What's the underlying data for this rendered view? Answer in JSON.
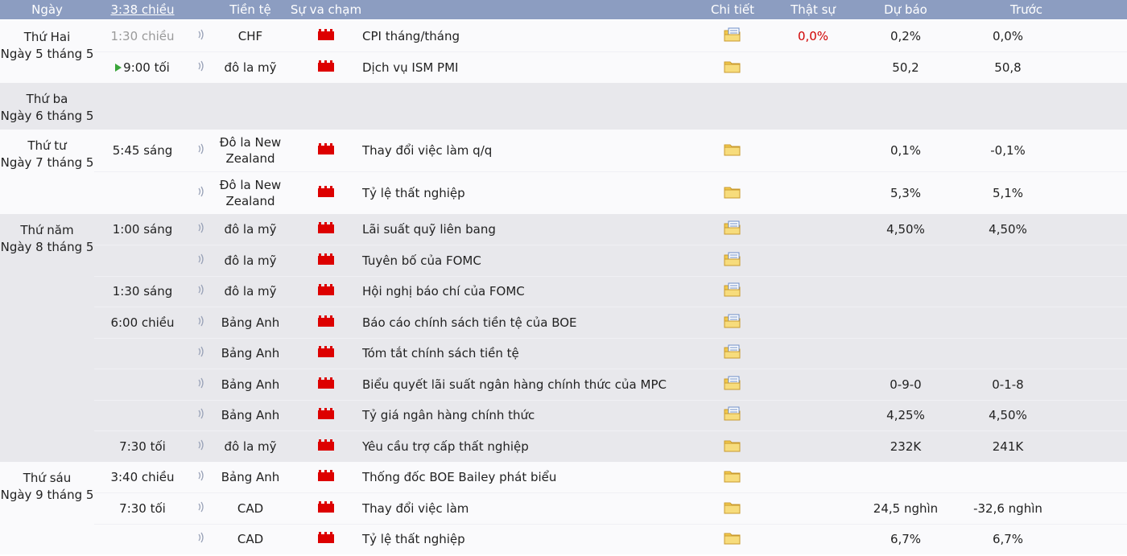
{
  "header": {
    "date": "Ngày",
    "time": "3:38 chiều",
    "currency": "Tiền tệ",
    "impact": "Sự va chạm",
    "detail": "Chi tiết",
    "actual": "Thật sự",
    "forecast": "Dự báo",
    "previous": "Trước"
  },
  "days": [
    {
      "weekday": "Thứ Hai",
      "date": "Ngày 5 tháng 5",
      "shade": "white",
      "rows": [
        {
          "time": "1:30 chiều",
          "time_faded": true,
          "currency": "CHF",
          "event": "CPI tháng/tháng",
          "detail_icon": "folder-doc",
          "actual": "0,0%",
          "actual_color": "#d00000",
          "forecast": "0,2%",
          "previous": "0,0%",
          "height": 39
        },
        {
          "time": "9:00 tối",
          "playing": true,
          "currency": "đô la mỹ",
          "event": "Dịch vụ ISM PMI",
          "detail_icon": "folder",
          "actual": "",
          "forecast": "50,2",
          "previous": "50,8",
          "height": 39
        }
      ]
    },
    {
      "weekday": "Thứ ba",
      "date": "Ngày 6 tháng 5",
      "shade": "gray",
      "rows": []
    },
    {
      "weekday": "Thứ tư",
      "date": "Ngày 7 tháng 5",
      "shade": "white",
      "rows": [
        {
          "time": "5:45 sáng",
          "currency": "Đô la New Zealand",
          "currency_lines": [
            "Đô la New",
            "Zealand"
          ],
          "event": "Thay đổi việc làm q/q",
          "detail_icon": "folder",
          "actual": "",
          "forecast": "0,1%",
          "previous": "-0,1%",
          "height": 52
        },
        {
          "time": "",
          "currency": "Đô la New Zealand",
          "currency_lines": [
            "Đô la New",
            "Zealand"
          ],
          "event": "Tỷ lệ thất nghiệp",
          "detail_icon": "folder",
          "actual": "",
          "forecast": "5,3%",
          "previous": "5,1%",
          "height": 53
        }
      ]
    },
    {
      "weekday": "Thứ năm",
      "date": "Ngày 8 tháng 5",
      "shade": "gray",
      "rows": [
        {
          "time": "1:00 sáng",
          "currency": "đô la mỹ",
          "event": "Lãi suất quỹ liên bang",
          "detail_icon": "folder-doc",
          "actual": "",
          "forecast": "4,50%",
          "previous": "4,50%",
          "height": 38
        },
        {
          "time": "",
          "currency": "đô la mỹ",
          "event": "Tuyên bố của FOMC",
          "detail_icon": "folder-doc",
          "actual": "",
          "forecast": "",
          "previous": "",
          "height": 39
        },
        {
          "time": "1:30 sáng",
          "currency": "đô la mỹ",
          "event": "Hội nghị báo chí của FOMC",
          "detail_icon": "folder-doc",
          "actual": "",
          "forecast": "",
          "previous": "",
          "height": 38
        },
        {
          "time": "6:00 chiều",
          "currency": "Bảng Anh",
          "event": "Báo cáo chính sách tiền tệ của BOE",
          "detail_icon": "folder-doc",
          "actual": "",
          "forecast": "",
          "previous": "",
          "height": 39
        },
        {
          "time": "",
          "currency": "Bảng Anh",
          "event": "Tóm tắt chính sách tiền tệ",
          "detail_icon": "folder-doc",
          "actual": "",
          "forecast": "",
          "previous": "",
          "height": 38
        },
        {
          "time": "",
          "currency": "Bảng Anh",
          "event": "Biểu quyết lãi suất ngân hàng chính thức của MPC",
          "detail_icon": "folder-doc",
          "actual": "",
          "forecast": "0-9-0",
          "previous": "0-1-8",
          "height": 39
        },
        {
          "time": "",
          "currency": "Bảng Anh",
          "event": "Tỷ giá ngân hàng chính thức",
          "detail_icon": "folder-doc",
          "actual": "",
          "forecast": "4,25%",
          "previous": "4,50%",
          "height": 38
        },
        {
          "time": "7:30 tối",
          "currency": "đô la mỹ",
          "event": "Yêu cầu trợ cấp thất nghiệp",
          "detail_icon": "folder",
          "actual": "",
          "forecast": "232K",
          "previous": "241K",
          "height": 39
        }
      ]
    },
    {
      "weekday": "Thứ sáu",
      "date": "Ngày 9 tháng 5",
      "shade": "white",
      "rows": [
        {
          "time": "3:40 chiều",
          "currency": "Bảng Anh",
          "event": "Thống đốc BOE Bailey phát biểu",
          "detail_icon": "folder",
          "actual": "",
          "forecast": "",
          "previous": "",
          "height": 38
        },
        {
          "time": "7:30 tối",
          "currency": "CAD",
          "event": "Thay đổi việc làm",
          "detail_icon": "folder",
          "actual": "",
          "forecast": "24,5 nghìn",
          "previous": "-32,6 nghìn",
          "height": 39
        },
        {
          "time": "",
          "currency": "CAD",
          "event": "Tỷ lệ thất nghiệp",
          "detail_icon": "folder",
          "actual": "",
          "forecast": "6,7%",
          "previous": "6,7%",
          "height": 38
        }
      ]
    }
  ],
  "colors": {
    "header_bg": "#8c9dc1",
    "impact_high": "#dd0000",
    "actual_negative": "#d00000",
    "row_white": "#fafafc",
    "row_gray": "#e8e8ec"
  },
  "icons": {
    "sound": "speaker-wave-icon",
    "impact": "high-impact-icon",
    "detail": "folder-icon",
    "detail_doc": "folder-document-icon",
    "play": "play-icon"
  }
}
